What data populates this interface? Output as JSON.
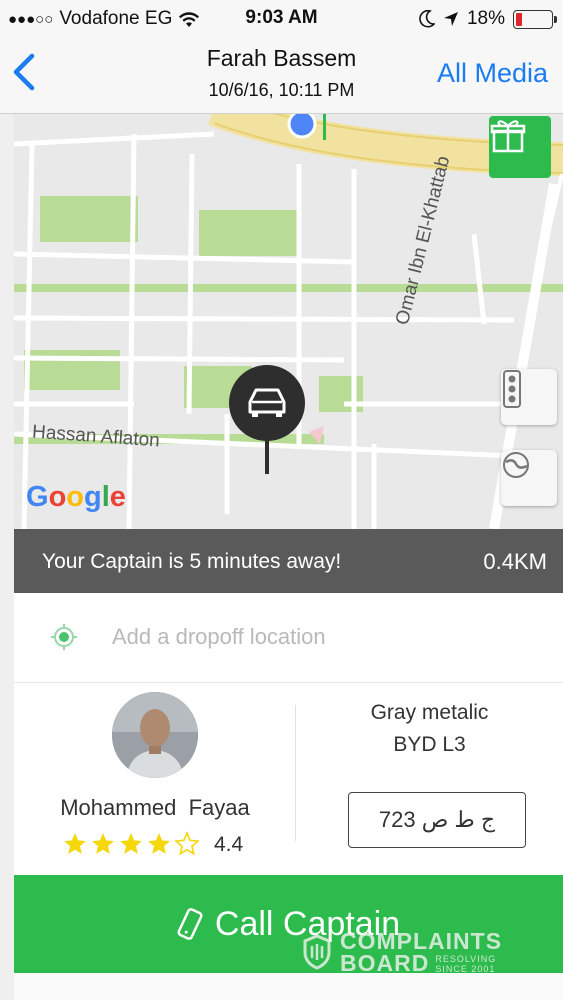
{
  "status_bar": {
    "carrier": "Vodafone EG",
    "time": "9:03 AM",
    "battery": "18%",
    "battery_level": 0.18,
    "signal_dots": "●●●○○"
  },
  "nav": {
    "title": "Farah Bassem",
    "subtitle": "10/6/16, 10:11 PM",
    "right_action": "All Media"
  },
  "map": {
    "street_1": "Hassan Aflaton",
    "street_2": "Omar Ibn El-Khattab",
    "street_2_partial": "Or",
    "provider_logo": "Google"
  },
  "trip": {
    "eta_message": "Your Captain is 5 minutes away!",
    "distance": "0.4KM",
    "dropoff_placeholder": "Add a dropoff location"
  },
  "driver": {
    "name": "Mohammed  Fayaa",
    "rating": "4.4",
    "stars_filled": 4,
    "stars_total": 5,
    "car_color": "Gray metalic",
    "car_model": "BYD L3",
    "plate": "ج ط ص 723"
  },
  "actions": {
    "call_label": "Call Captain"
  },
  "watermark": {
    "line1": "COMPLAINTS",
    "line2": "BOARD",
    "tagline": "RESOLVING SINCE 2001"
  },
  "colors": {
    "accent_green": "#2dbb4d",
    "ios_blue": "#1a7cf0",
    "eta_bar": "#5a5a5a"
  }
}
